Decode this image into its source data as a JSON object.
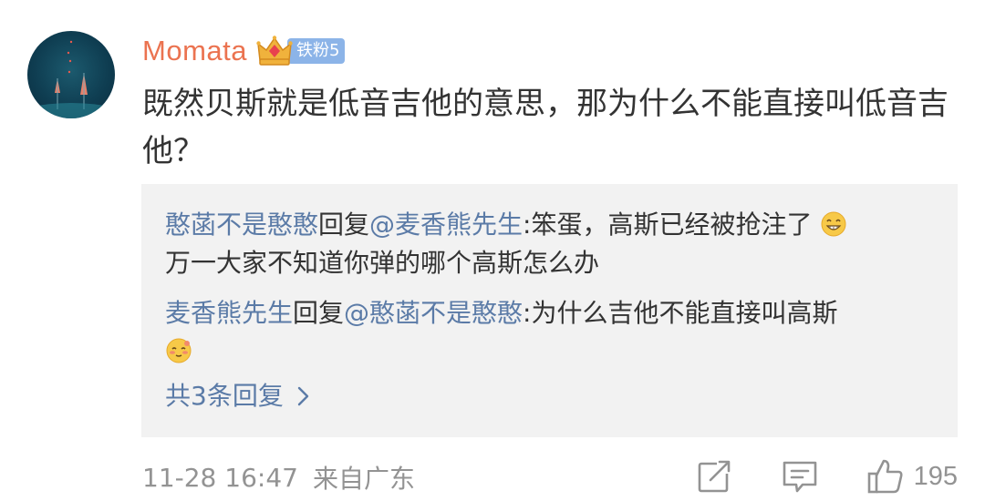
{
  "comment": {
    "username": "Momata",
    "fan_badge": "铁粉5",
    "text": "既然贝斯就是低音吉他的意思，那为什么不能直接叫低音吉他？",
    "meta": {
      "time": "11-28 16:47",
      "location": "来自广东"
    },
    "likes": "195"
  },
  "replies": [
    {
      "user": "憨菡不是憨憨",
      "reply_word": "回复",
      "target": "@麦香熊先生",
      "text": ":笨蛋，高斯已经被抢注了",
      "emoji_icon": "grin-emoji-icon",
      "text_after": "万一大家不知道你弹的哪个高斯怎么办"
    },
    {
      "user": "麦香熊先生",
      "reply_word": "回复",
      "target": "@憨菡不是憨憨",
      "text": ":为什么吉他不能直接叫高斯",
      "emoji_icon": "shy-emoji-icon"
    }
  ],
  "more_replies": "共3条回复",
  "icons": {
    "badge": "crown-icon",
    "share": "share-icon",
    "comment": "comment-icon",
    "like": "thumbs-up-icon",
    "more": "chevron-right-icon"
  },
  "colors": {
    "username": "#eb7350",
    "link": "#5b7ba7",
    "muted": "#939393",
    "reply_bg": "#f2f2f2",
    "badge_bg": "#8cb4e8"
  }
}
